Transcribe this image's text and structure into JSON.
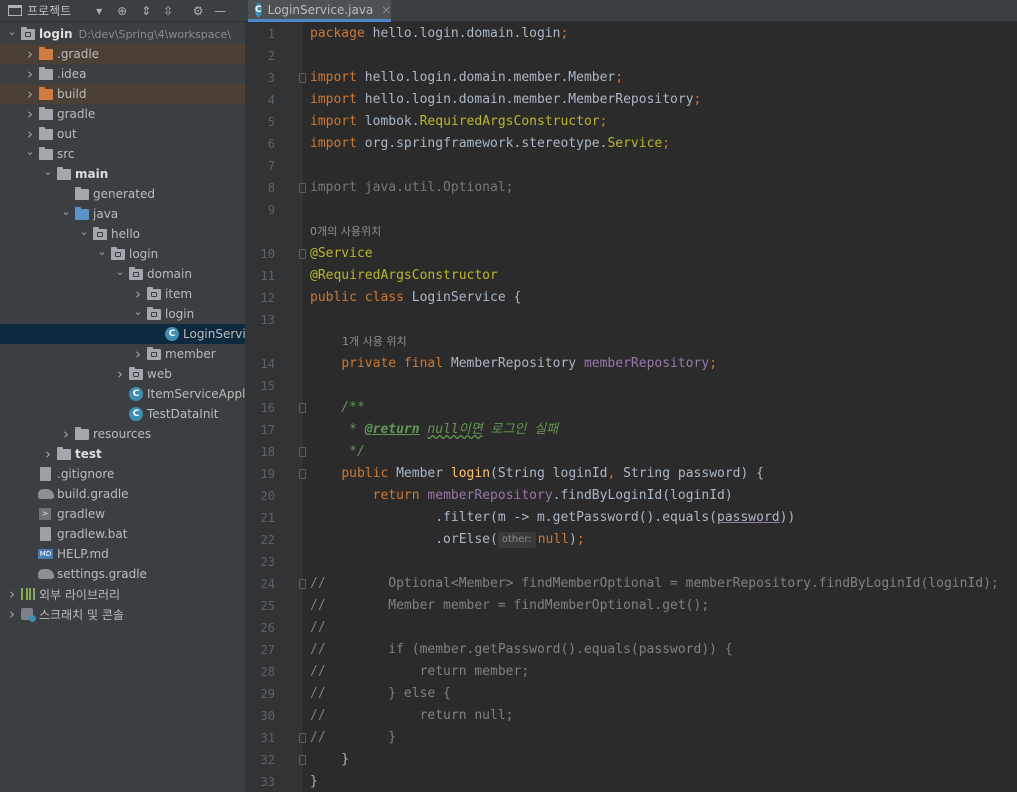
{
  "project_panel": {
    "title": "프로젝트",
    "toolbar_icons": [
      "locate-icon",
      "expand-all-icon",
      "collapse-all-icon",
      "gear-icon",
      "minimize-icon"
    ],
    "tree": [
      {
        "label": "login",
        "path": "D:\\dev\\Spring\\4\\workspace\\",
        "indent": 0,
        "arrow": "down",
        "icon": "project-folder",
        "bold": true
      },
      {
        "label": ".gradle",
        "indent": 1,
        "arrow": "right",
        "icon": "folder-orange",
        "highlight": true
      },
      {
        "label": ".idea",
        "indent": 1,
        "arrow": "right",
        "icon": "folder"
      },
      {
        "label": "build",
        "indent": 1,
        "arrow": "right",
        "icon": "folder-orange",
        "highlight": true
      },
      {
        "label": "gradle",
        "indent": 1,
        "arrow": "right",
        "icon": "folder"
      },
      {
        "label": "out",
        "indent": 1,
        "arrow": "right",
        "icon": "folder"
      },
      {
        "label": "src",
        "indent": 1,
        "arrow": "down",
        "icon": "folder"
      },
      {
        "label": "main",
        "indent": 2,
        "arrow": "down",
        "icon": "folder",
        "bold": true
      },
      {
        "label": "generated",
        "indent": 3,
        "arrow": "none",
        "icon": "folder-gen"
      },
      {
        "label": "java",
        "indent": 3,
        "arrow": "down",
        "icon": "folder-blue"
      },
      {
        "label": "hello",
        "indent": 4,
        "arrow": "down",
        "icon": "package"
      },
      {
        "label": "login",
        "indent": 5,
        "arrow": "down",
        "icon": "package"
      },
      {
        "label": "domain",
        "indent": 6,
        "arrow": "down",
        "icon": "package"
      },
      {
        "label": "item",
        "indent": 7,
        "arrow": "right",
        "icon": "package"
      },
      {
        "label": "login",
        "indent": 7,
        "arrow": "down",
        "icon": "package"
      },
      {
        "label": "LoginServic",
        "indent": 8,
        "arrow": "none",
        "icon": "class",
        "selected": true
      },
      {
        "label": "member",
        "indent": 7,
        "arrow": "right",
        "icon": "package"
      },
      {
        "label": "web",
        "indent": 6,
        "arrow": "right",
        "icon": "package"
      },
      {
        "label": "ItemServiceApplic",
        "indent": 6,
        "arrow": "none",
        "icon": "class-run"
      },
      {
        "label": "TestDataInit",
        "indent": 6,
        "arrow": "none",
        "icon": "class"
      },
      {
        "label": "resources",
        "indent": 3,
        "arrow": "right",
        "icon": "folder-res"
      },
      {
        "label": "test",
        "indent": 2,
        "arrow": "right",
        "icon": "folder",
        "bold": true
      },
      {
        "label": ".gitignore",
        "indent": 1,
        "arrow": "none",
        "icon": "file"
      },
      {
        "label": "build.gradle",
        "indent": 1,
        "arrow": "none",
        "icon": "gradle"
      },
      {
        "label": "gradlew",
        "indent": 1,
        "arrow": "none",
        "icon": "terminal"
      },
      {
        "label": "gradlew.bat",
        "indent": 1,
        "arrow": "none",
        "icon": "file"
      },
      {
        "label": "HELP.md",
        "indent": 1,
        "arrow": "none",
        "icon": "markdown"
      },
      {
        "label": "settings.gradle",
        "indent": 1,
        "arrow": "none",
        "icon": "gradle"
      },
      {
        "label": "외부 라이브러리",
        "indent": 0,
        "arrow": "right",
        "icon": "library"
      },
      {
        "label": "스크래치 및 콘솔",
        "indent": 0,
        "arrow": "right",
        "icon": "scratch"
      }
    ]
  },
  "editor": {
    "tab": {
      "name": "LoginService.java",
      "close": "×"
    },
    "usage_hints": {
      "class": "0개의 사용위치",
      "field": "1개 사용 위치"
    },
    "param_hint": "other:",
    "lines": {
      "l1": {
        "n": "1",
        "parts": [
          [
            "kw",
            "package "
          ],
          [
            "",
            "hello.login.domain.login"
          ],
          [
            "kw",
            ";"
          ]
        ]
      },
      "l2": {
        "n": "2",
        "parts": []
      },
      "l3": {
        "n": "3",
        "parts": [
          [
            "kw",
            "import "
          ],
          [
            "",
            "hello.login.domain.member."
          ],
          [
            "",
            "Member"
          ],
          [
            "kw",
            ";"
          ]
        ]
      },
      "l4": {
        "n": "4",
        "parts": [
          [
            "kw",
            "import "
          ],
          [
            "",
            "hello.login.domain.member."
          ],
          [
            "",
            "MemberRepository"
          ],
          [
            "kw",
            ";"
          ]
        ]
      },
      "l5": {
        "n": "5",
        "parts": [
          [
            "kw",
            "import "
          ],
          [
            "",
            "lombok."
          ],
          [
            "an",
            "RequiredArgsConstructor"
          ],
          [
            "kw",
            ";"
          ]
        ]
      },
      "l6": {
        "n": "6",
        "parts": [
          [
            "kw",
            "import "
          ],
          [
            "",
            "org.springframework.stereotype."
          ],
          [
            "an",
            "Service"
          ],
          [
            "kw",
            ";"
          ]
        ]
      },
      "l7": {
        "n": "7",
        "parts": []
      },
      "l8": {
        "n": "8",
        "parts": [
          [
            "dim",
            "import java.util.Optional;"
          ]
        ]
      },
      "l9": {
        "n": "9",
        "parts": []
      },
      "l10": {
        "n": "10",
        "parts": [
          [
            "an",
            "@Service"
          ]
        ]
      },
      "l11": {
        "n": "11",
        "parts": [
          [
            "an",
            "@RequiredArgsConstructor"
          ]
        ]
      },
      "l12": {
        "n": "12",
        "parts": [
          [
            "kw",
            "public class "
          ],
          [
            "",
            "LoginService {"
          ]
        ]
      },
      "l13": {
        "n": "13",
        "parts": []
      },
      "l14": {
        "n": "14",
        "parts": [
          [
            "",
            "    "
          ],
          [
            "kw",
            "private final "
          ],
          [
            "",
            "MemberRepository "
          ],
          [
            "fld",
            "memberRepository"
          ],
          [
            "kw",
            ";"
          ]
        ]
      },
      "l15": {
        "n": "15",
        "parts": []
      },
      "l16": {
        "n": "16",
        "parts": [
          [
            "doc",
            "    /**"
          ]
        ]
      },
      "l17": {
        "n": "17",
        "parts": [
          [
            "doc",
            "     * "
          ],
          [
            "doctag",
            "@return"
          ],
          [
            "doc",
            " "
          ],
          [
            "doc-wavy",
            "null이면"
          ],
          [
            "doc",
            " 로그인 실패"
          ]
        ]
      },
      "l18": {
        "n": "18",
        "parts": [
          [
            "doc",
            "     */"
          ]
        ]
      },
      "l19": {
        "n": "19",
        "parts": [
          [
            "",
            "    "
          ],
          [
            "kw",
            "public "
          ],
          [
            "",
            "Member "
          ],
          [
            "fn",
            "login"
          ],
          [
            "",
            "(String loginId"
          ],
          [
            "kw",
            ", "
          ],
          [
            "",
            "String password) {"
          ]
        ]
      },
      "l20": {
        "n": "20",
        "parts": [
          [
            "",
            "        "
          ],
          [
            "kw",
            "return "
          ],
          [
            "fld",
            "memberRepository"
          ],
          [
            "",
            ".findByLoginId(loginId)"
          ]
        ]
      },
      "l21": {
        "n": "21",
        "parts": [
          [
            "",
            "                .filter(m -> m.getPassword().equals("
          ],
          [
            "uline",
            "password"
          ],
          [
            "",
            "))"
          ]
        ]
      },
      "l22": {
        "n": "22",
        "parts": [
          [
            "",
            "                .orElse("
          ],
          [
            "hint",
            "other:"
          ],
          [
            "kw",
            "null"
          ],
          [
            "",
            ")"
          ],
          [
            "kw",
            ";"
          ]
        ]
      },
      "l23": {
        "n": "23",
        "parts": []
      },
      "l24": {
        "n": "24",
        "parts": [
          [
            "cm",
            "//        Optional<Member> findMemberOptional = memberRepository.findByLoginId(loginId);"
          ]
        ]
      },
      "l25": {
        "n": "25",
        "parts": [
          [
            "cm",
            "//        Member member = findMemberOptional.get();"
          ]
        ]
      },
      "l26": {
        "n": "26",
        "parts": [
          [
            "cm",
            "//"
          ]
        ]
      },
      "l27": {
        "n": "27",
        "parts": [
          [
            "cm",
            "//        if (member.getPassword().equals(password)) {"
          ]
        ]
      },
      "l28": {
        "n": "28",
        "parts": [
          [
            "cm",
            "//            return member;"
          ]
        ]
      },
      "l29": {
        "n": "29",
        "parts": [
          [
            "cm",
            "//        } else {"
          ]
        ]
      },
      "l30": {
        "n": "30",
        "parts": [
          [
            "cm",
            "//            return null;"
          ]
        ]
      },
      "l31": {
        "n": "31",
        "parts": [
          [
            "cm",
            "//        }"
          ]
        ]
      },
      "l32": {
        "n": "32",
        "parts": [
          [
            "",
            "    }"
          ]
        ]
      },
      "l33": {
        "n": "33",
        "parts": [
          [
            "",
            "}"
          ]
        ]
      }
    }
  },
  "colors": {
    "keyword": "#cc7832",
    "annotation": "#bbb529",
    "field": "#9876aa",
    "comment": "#808080",
    "javadoc": "#629755",
    "method": "#ffc66d",
    "text": "#a9b7c6",
    "selection": "#0d293e"
  }
}
